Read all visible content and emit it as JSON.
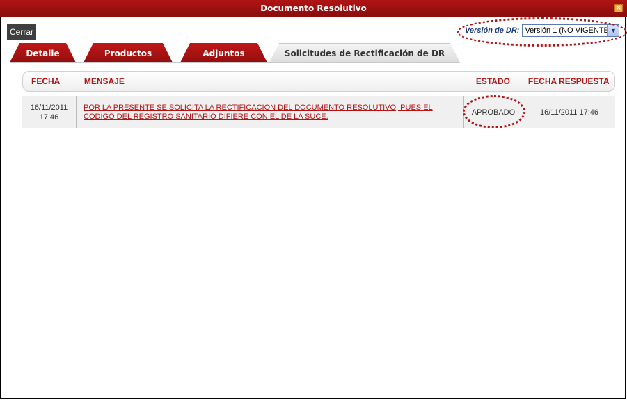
{
  "window": {
    "title": "Documento Resolutivo",
    "close_icon": "close-icon"
  },
  "toolbar": {
    "close_label": "Cerrar"
  },
  "version": {
    "label": "Versión de DR:",
    "selected": "Versión 1 (NO VIGENTE)"
  },
  "tabs": [
    {
      "label": "Detalle",
      "active": false
    },
    {
      "label": "Productos",
      "active": false
    },
    {
      "label": "Adjuntos",
      "active": false
    },
    {
      "label": "Solicitudes de Rectificación de DR",
      "active": true
    }
  ],
  "table": {
    "headers": [
      "FECHA",
      "MENSAJE",
      "ESTADO",
      "FECHA RESPUESTA"
    ],
    "rows": [
      {
        "fecha": "16/11/2011\n17:46",
        "fecha_line1": "16/11/2011",
        "fecha_line2": "17:46",
        "mensaje": "POR LA PRESENTE SE SOLICITA LA RECTIFICACIÓN DEL DOCUMENTO RESOLUTIVO, PUES EL CODIGO DEL REGISTRO SANITARIO DIFIERE CON EL DE LA SUCE.",
        "estado": "APROBADO",
        "fecha_respuesta": "16/11/2011 17:46"
      }
    ]
  },
  "colors": {
    "brand_red": "#b01414",
    "annotation_red": "#b01414",
    "link_red": "#b01414"
  }
}
